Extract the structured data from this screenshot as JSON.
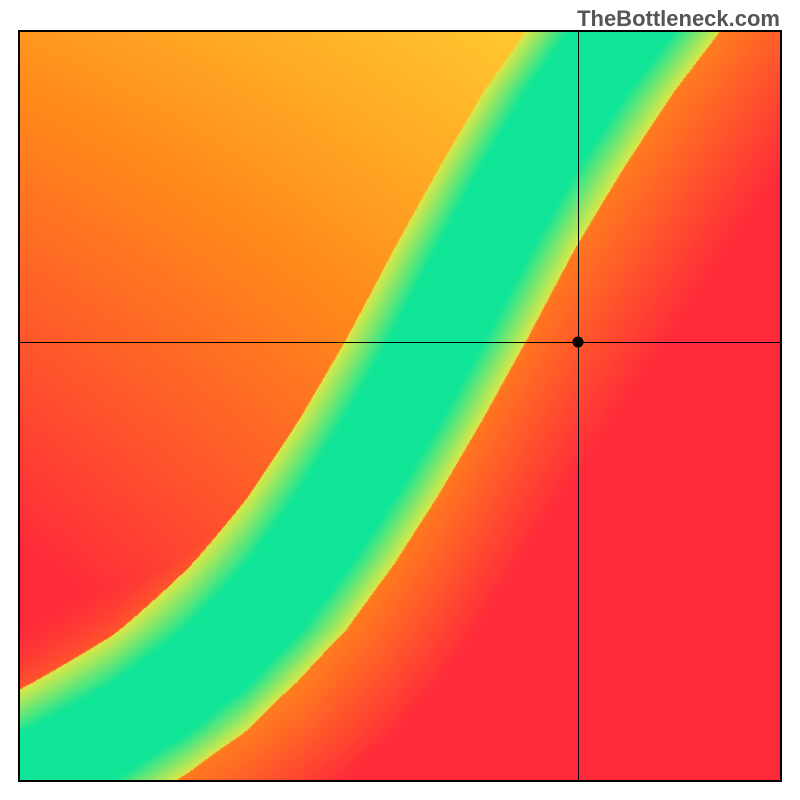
{
  "watermark": "TheBottleneck.com",
  "chart_data": {
    "type": "heatmap",
    "title": "",
    "xlabel": "",
    "ylabel": "",
    "xlim": [
      0,
      1
    ],
    "ylim": [
      0,
      1
    ],
    "color_stops": {
      "red": "#ff2a3a",
      "orange": "#ff8a1a",
      "yellow": "#ffe83a",
      "green": "#10e598"
    },
    "ridge": [
      {
        "x": 0.0,
        "y": 0.0
      },
      {
        "x": 0.12,
        "y": 0.06
      },
      {
        "x": 0.22,
        "y": 0.13
      },
      {
        "x": 0.3,
        "y": 0.2
      },
      {
        "x": 0.37,
        "y": 0.29
      },
      {
        "x": 0.43,
        "y": 0.38
      },
      {
        "x": 0.49,
        "y": 0.48
      },
      {
        "x": 0.55,
        "y": 0.59
      },
      {
        "x": 0.61,
        "y": 0.71
      },
      {
        "x": 0.67,
        "y": 0.82
      },
      {
        "x": 0.73,
        "y": 0.92
      },
      {
        "x": 0.79,
        "y": 1.0
      }
    ],
    "ridge_half_width": 0.055,
    "crosshair": {
      "x": 0.735,
      "y": 0.585
    },
    "marker": {
      "x": 0.735,
      "y": 0.585
    },
    "grid": false,
    "legend": null
  }
}
